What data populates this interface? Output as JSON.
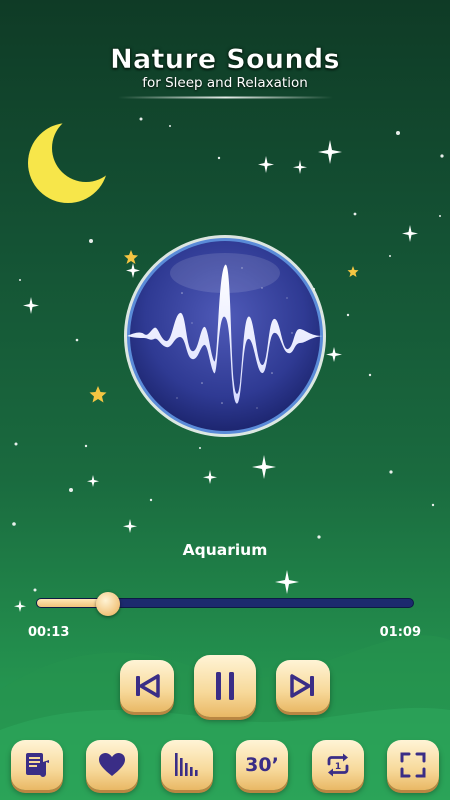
{
  "header": {
    "title": "Nature Sounds",
    "subtitle": "for Sleep and Relaxation"
  },
  "player": {
    "track_name": "Aquarium",
    "elapsed": "00:13",
    "total": "01:09",
    "progress_fraction": 0.19
  },
  "controls": {
    "prev_icon": "skip-previous-icon",
    "pause_icon": "pause-icon",
    "next_icon": "skip-next-icon"
  },
  "bottom_bar": {
    "playlist_icon": "playlist-music-icon",
    "favorite_icon": "heart-icon",
    "equalizer_icon": "equalizer-icon",
    "timer_label": "30’",
    "repeat_icon": "repeat-one-icon",
    "fullscreen_icon": "fullscreen-icon"
  },
  "colors": {
    "background_top": "#0f3b26",
    "background_bottom": "#2aa85a",
    "button_face": "#f7d99a",
    "icon_color": "#3a2d86",
    "progress_track": "#1c2a6e",
    "moon": "#f7e64a"
  }
}
